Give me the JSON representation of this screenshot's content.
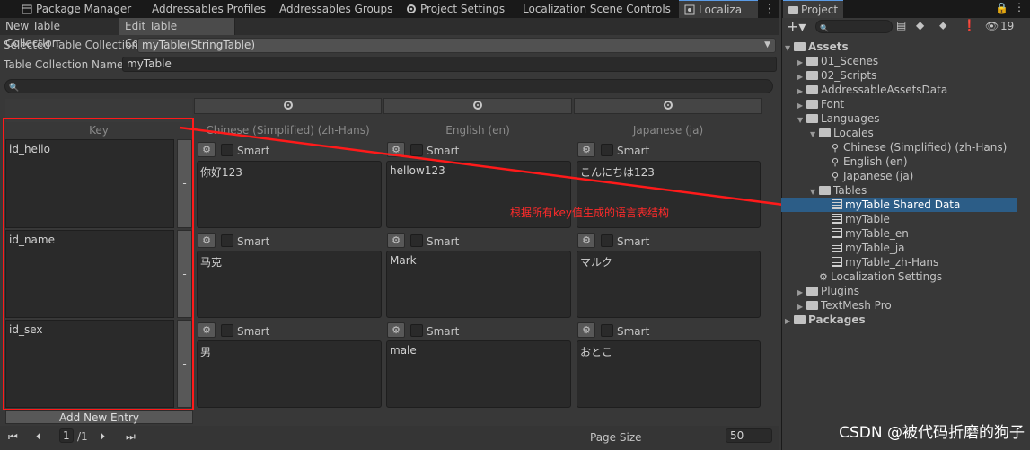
{
  "tabs": [
    {
      "label": "Package Manager",
      "icon": "package-icon"
    },
    {
      "label": "Addressables Profiles",
      "icon": ""
    },
    {
      "label": "Addressables Groups",
      "icon": ""
    },
    {
      "label": "Project Settings",
      "icon": "gear-icon"
    },
    {
      "label": "Localization Scene Controls",
      "icon": ""
    },
    {
      "label": "Localiza",
      "icon": "localization-icon"
    }
  ],
  "subtabs": [
    "New Table Collection",
    "Edit Table Collection"
  ],
  "form": {
    "selected_label": "Selected Table Collection",
    "selected_value": "myTable(StringTable)",
    "name_label": "Table Collection Name",
    "name_value": "myTable"
  },
  "table": {
    "key_header": "Key",
    "columns": [
      "Chinese (Simplified) (zh-Hans)",
      "English (en)",
      "Japanese (ja)"
    ],
    "smart_label": "Smart",
    "remove_label": "-",
    "rows": [
      {
        "key": "id_hello",
        "values": [
          "你好123",
          "hellow123",
          "こんにちは123"
        ]
      },
      {
        "key": "id_name",
        "values": [
          "马克",
          "Mark",
          "マルク"
        ]
      },
      {
        "key": "id_sex",
        "values": [
          "男",
          "male",
          "おとこ"
        ]
      }
    ],
    "add_entry": "Add New Entry"
  },
  "pager": {
    "page": "1",
    "total": "/1",
    "page_size_label": "Page Size",
    "page_size": "50"
  },
  "annotation": "根据所有key值生成的语言表结构",
  "project": {
    "tab_label": "Project",
    "hidden_count": "19",
    "tree": [
      {
        "label": "Assets",
        "depth": 0,
        "icon": "folder",
        "open": true,
        "bold": true
      },
      {
        "label": "01_Scenes",
        "depth": 1,
        "icon": "folder"
      },
      {
        "label": "02_Scripts",
        "depth": 1,
        "icon": "folder"
      },
      {
        "label": "AddressableAssetsData",
        "depth": 1,
        "icon": "folder"
      },
      {
        "label": "Font",
        "depth": 1,
        "icon": "folder"
      },
      {
        "label": "Languages",
        "depth": 1,
        "icon": "folder",
        "open": true
      },
      {
        "label": "Locales",
        "depth": 2,
        "icon": "folder",
        "open": true
      },
      {
        "label": "Chinese (Simplified) (zh-Hans)",
        "depth": 3,
        "icon": "locale"
      },
      {
        "label": "English (en)",
        "depth": 3,
        "icon": "locale"
      },
      {
        "label": "Japanese (ja)",
        "depth": 3,
        "icon": "locale"
      },
      {
        "label": "Tables",
        "depth": 2,
        "icon": "folder",
        "open": true
      },
      {
        "label": "myTable Shared Data",
        "depth": 3,
        "icon": "table",
        "selected": true
      },
      {
        "label": "myTable",
        "depth": 3,
        "icon": "table"
      },
      {
        "label": "myTable_en",
        "depth": 3,
        "icon": "table"
      },
      {
        "label": "myTable_ja",
        "depth": 3,
        "icon": "table"
      },
      {
        "label": "myTable_zh-Hans",
        "depth": 3,
        "icon": "table"
      },
      {
        "label": "Localization Settings",
        "depth": 2,
        "icon": "settings"
      },
      {
        "label": "Plugins",
        "depth": 1,
        "icon": "folder"
      },
      {
        "label": "TextMesh Pro",
        "depth": 1,
        "icon": "folder"
      },
      {
        "label": "Packages",
        "depth": 0,
        "icon": "folder",
        "bold": true
      }
    ]
  },
  "watermark": "CSDN @被代码折磨的狗子",
  "colors": {
    "annotation": "#ff2a2a",
    "selection": "#2c5d87",
    "tab_accent": "#5a9be6"
  }
}
